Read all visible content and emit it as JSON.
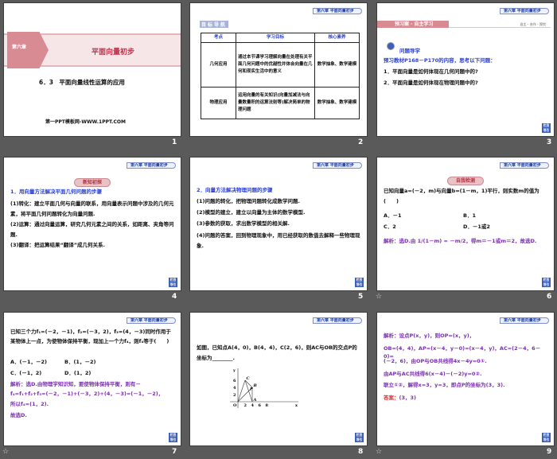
{
  "header_tag": "第六章 平面向量初步",
  "nav_button": "栏目导引",
  "animation_icon": "star-icon",
  "slides": [
    {
      "number": "1",
      "chapter_badge": "第六章",
      "title": "平面向量初步",
      "subtitle": "6．3　平面向量线性运算的应用",
      "footer": "第一PPT模板网-WWW.1PPT.COM"
    },
    {
      "number": "2",
      "section": "目标导航",
      "table": {
        "headers": [
          "考点",
          "学习目标",
          "核心素养"
        ],
        "rows": [
          [
            "几何应用",
            "通过本节课学习理解向量在处理有关平面几何问题中的优越性并体会向量在几何和现实生活中的意义",
            "数学抽象、数学建模"
          ],
          [
            "物理应用",
            "运用向量的有关知识(向量加减法与向量数量积的运算法则等)解决简单的物理问题",
            "数学抽象、数学建模"
          ]
        ]
      }
    },
    {
      "number": "3",
      "banner": "预习案 · 自主学习",
      "banner_right": "自主 · 合作 · 探究",
      "heading": "问题导学",
      "intro": "预习教材P168－P170的内容，思考以下问题：",
      "items": [
        "1．平面向量是如何体现在几何问题中的?",
        "2．平面向量是如何体现在物理问题中的?"
      ]
    },
    {
      "number": "4",
      "pill": "新知初探",
      "heading": "1．用向量方法解决平面几何问题的步骤",
      "lines": [
        "(1)转化：建立平面几何与向量的联系，用向量表示问题中涉及的几何元素，将平面几何问题转化为向量问题.",
        "(2)运算：通过向量运算，研究几何元素之间的关系，如距离、夹角等问题.",
        "(3)翻译：把运算结果“翻译”成几何关系."
      ]
    },
    {
      "number": "5",
      "heading": "2．向量方法解决物理问题的步骤",
      "lines": [
        "(1)问题的转化，把物理问题转化成数学问题.",
        "(2)模型的建立，建立以向量为主体的数学模型.",
        "(3)参数的获取，求出数学模型的相关解.",
        "(4)问题的答案，回到物理现象中，用已经获取的数值去解释一些物理现象."
      ]
    },
    {
      "number": "6",
      "pill": "自我检测",
      "question": "已知向量a=(－2，m)与向量b=(1－m，1)平行，则实数m的值为(　　)",
      "options": [
        "A．－1",
        "B．1",
        "C．2",
        "D．－1或2"
      ],
      "solution": "解析：选D.由 1/(1－m) = －m/2，得m＝－1或m＝2，故选D."
    },
    {
      "number": "7",
      "question": "已知三个力f₁=(－2，－1)，f₂=(－3，2)，f₃=(4，－3)同时作用于某物体上一点，为使物体保持平衡，现加上一个力f₄，则f₄等于(　　)",
      "options": [
        "A．(－1，－2)",
        "B．(1，－2)",
        "C．(－1，2)",
        "D．(1，2)"
      ],
      "solution": [
        "解析：选D.由物理学知识知，要使物体保持平衡，则有－f₄=f₁+f₂+f₃=(－2，－1)+(－3，2)+(4，－3)=(－1，－2)，",
        "所以f₄=(1，2).",
        "故选D."
      ]
    },
    {
      "number": "8",
      "question": "如图，已知点A(4，0)，B(4，4)，C(2，6)，则AC与OB的交点P的坐标为________.",
      "figure": {
        "x_ticks": [
          "2",
          "4",
          "6",
          "8"
        ],
        "y_ticks": [
          "2",
          "4",
          "6"
        ],
        "x_label": "x",
        "y_label": "y",
        "origin": "O",
        "points": {
          "A": [
            4,
            0
          ],
          "B": [
            4,
            4
          ],
          "C": [
            2,
            6
          ],
          "P": [
            3,
            3
          ]
        }
      }
    },
    {
      "number": "9",
      "lines": [
        "解析：设点P(x，y)，则OP=(x，y)，",
        "OB=(4，4)，AP=(x－4，y－0)=(x－4，y)，AC=(2－4，6－0)=",
        "(－2，6)，由OP与OB共线得4x－4y=0①.",
        "由AP与AC共线得6(x－4)－(－2)y=0②.",
        "联立①②，解得x=3，y=3，即点P的坐标为(3，3)."
      ],
      "answer_label": "答案：",
      "answer": "(3，3)"
    }
  ]
}
